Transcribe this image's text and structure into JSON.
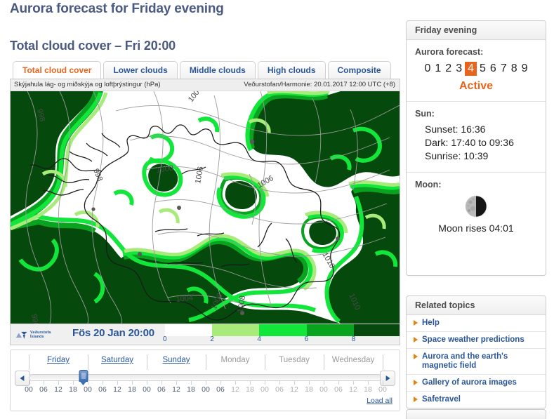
{
  "page": {
    "title": "Aurora forecast for Friday evening",
    "section_title": "Total cloud cover – Fri 20:00"
  },
  "tabs": [
    {
      "label": "Total cloud cover",
      "active": true
    },
    {
      "label": "Lower clouds",
      "active": false
    },
    {
      "label": "Middle clouds",
      "active": false
    },
    {
      "label": "High clouds",
      "active": false
    },
    {
      "label": "Composite",
      "active": false
    }
  ],
  "map": {
    "caption": "Skýjahula lág- og miðskýja og loftþrýstingur (hPa)",
    "source": "Veðurstofan/Harmonie: 20.01.2017 12:00 UTC (+8)",
    "logo_line1": "Veðurstofa",
    "logo_line2": "Íslands",
    "valid_time": "Fös 20 Jan 20:00",
    "isobar_labels": [
      "998",
      "1000",
      "1004",
      "1006",
      "1008",
      "1010"
    ],
    "legend": {
      "ticks": [
        "0",
        "2",
        "4",
        "6",
        "8"
      ],
      "colors": [
        "#ffffff",
        "#a8eb7a",
        "#13e63a",
        "#0aa31f",
        "#05490c"
      ]
    }
  },
  "timeline": {
    "days": [
      {
        "label": "Friday",
        "available": true
      },
      {
        "label": "Saturday",
        "available": true
      },
      {
        "label": "Sunday",
        "available": true
      },
      {
        "label": "Monday",
        "available": false
      },
      {
        "label": "Tuesday",
        "available": false
      },
      {
        "label": "Wednesday",
        "available": false
      }
    ],
    "hours": [
      "00",
      "06",
      "12",
      "18",
      "00",
      "06",
      "12",
      "18",
      "00",
      "06",
      "12",
      "18",
      "00",
      "06",
      "12",
      "18",
      "00",
      "06",
      "12",
      "18",
      "00",
      "06",
      "12",
      "18",
      "00"
    ],
    "available_hour_count": 13,
    "selected_hour_index": 4,
    "selected_value": "Fri 20:00",
    "prev_label": "◀",
    "next_label": "▶",
    "load_all_label": "Load all"
  },
  "sidebar": {
    "forecast_panel": {
      "header": "Friday evening",
      "aurora_label": "Aurora forecast:",
      "kp_values": [
        "0",
        "1",
        "2",
        "3",
        "4",
        "5",
        "6",
        "7",
        "8",
        "9"
      ],
      "kp_selected": "4",
      "kp_status": "Active",
      "kp_accent": "#e8641c",
      "sun_label": "Sun:",
      "sun_lines": [
        "Sunset: 16:36",
        "Dark: 17:40 to 09:36",
        "Sunrise: 10:39"
      ],
      "moon_label": "Moon:",
      "moon_icon": "moon-waning-quarter-icon",
      "moon_caption": "Moon rises 04:01"
    },
    "related_panel": {
      "header": "Related topics",
      "items": [
        "Help",
        "Space weather predictions",
        "Aurora and the earth's magnetic field",
        "Gallery of aurora images",
        "Safetravel"
      ]
    }
  }
}
